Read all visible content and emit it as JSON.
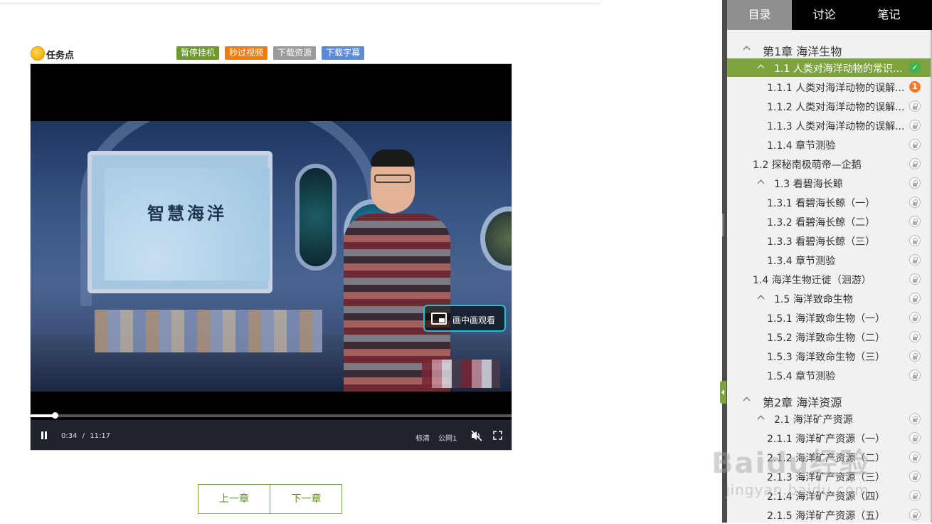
{
  "task": {
    "label": "任务点",
    "buttons": [
      "暂停挂机",
      "秒过视频",
      "下载资源",
      "下载字幕"
    ]
  },
  "video": {
    "slide_title": "智慧海洋",
    "pip_label": "画中画观看",
    "current_time": "0:34",
    "separator": "/",
    "duration": "11:17",
    "progress_fraction": 0.05,
    "quality": "标清",
    "line": "公网1"
  },
  "chapter_nav": {
    "prev": "上一章",
    "next": "下一章"
  },
  "sidebar": {
    "tabs": [
      "目录",
      "讨论",
      "笔记"
    ],
    "items": [
      {
        "label": "第1章 海洋生物",
        "level": "chapter",
        "expanded": true,
        "status": ""
      },
      {
        "label": "1.1 人类对海洋动物的常识误...",
        "level": "section",
        "expanded": true,
        "status": "done",
        "active": true
      },
      {
        "label": "1.1.1 人类对海洋动物的误解...",
        "level": "sub",
        "status": "num",
        "badge": "1"
      },
      {
        "label": "1.1.2 人类对海洋动物的误解...",
        "level": "sub",
        "status": "lock"
      },
      {
        "label": "1.1.3 人类对海洋动物的误解...",
        "level": "sub",
        "status": "lock"
      },
      {
        "label": "1.1.4 章节测验",
        "level": "sub",
        "status": "lock"
      },
      {
        "label": "1.2 探秘南极萌帝—企鹅",
        "level": "section-plain",
        "status": "lock"
      },
      {
        "label": "1.3 看碧海长鲸",
        "level": "section",
        "expanded": true,
        "status": "lock"
      },
      {
        "label": "1.3.1 看碧海长鲸（一）",
        "level": "sub",
        "status": "lock"
      },
      {
        "label": "1.3.2 看碧海长鲸（二）",
        "level": "sub",
        "status": "lock"
      },
      {
        "label": "1.3.3 看碧海长鲸（三）",
        "level": "sub",
        "status": "lock"
      },
      {
        "label": "1.3.4 章节测验",
        "level": "sub",
        "status": "lock"
      },
      {
        "label": "1.4 海洋生物迁徙（洄游）",
        "level": "section-plain",
        "status": "lock"
      },
      {
        "label": "1.5 海洋致命生物",
        "level": "section",
        "expanded": true,
        "status": "lock"
      },
      {
        "label": "1.5.1 海洋致命生物（一）",
        "level": "sub",
        "status": "lock"
      },
      {
        "label": "1.5.2 海洋致命生物（二）",
        "level": "sub",
        "status": "lock"
      },
      {
        "label": "1.5.3 海洋致命生物（三）",
        "level": "sub",
        "status": "lock"
      },
      {
        "label": "1.5.4 章节测验",
        "level": "sub",
        "status": "lock"
      },
      {
        "label": "第2章 海洋资源",
        "level": "chapter",
        "expanded": true,
        "status": ""
      },
      {
        "label": "2.1 海洋矿产资源",
        "level": "section",
        "expanded": true,
        "status": "lock"
      },
      {
        "label": "2.1.1 海洋矿产资源（一）",
        "level": "sub",
        "status": "lock"
      },
      {
        "label": "2.1.2 海洋矿产资源（二）",
        "level": "sub",
        "status": "lock"
      },
      {
        "label": "2.1.3 海洋矿产资源（三）",
        "level": "sub",
        "status": "lock"
      },
      {
        "label": "2.1.4 海洋矿产资源（四）",
        "level": "sub",
        "status": "lock"
      },
      {
        "label": "2.1.5 海洋矿产资源（五）",
        "level": "sub",
        "status": "lock"
      }
    ]
  },
  "watermark": {
    "line1": "Baidu经验",
    "line2": "jingyan.baidu.com"
  },
  "colors": {
    "accent_green": "#7da33e",
    "done": "#3fb34f",
    "badge": "#f5792b",
    "pip_border": "#20c1d8"
  }
}
